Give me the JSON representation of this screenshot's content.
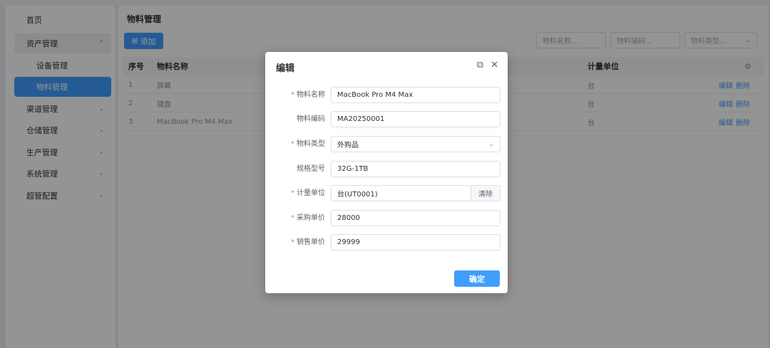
{
  "sidebar": {
    "items": [
      {
        "label": "首页",
        "chevron": ""
      },
      {
        "label": "资产管理",
        "chevron": "^"
      },
      {
        "label": "设备管理",
        "chevron": ""
      },
      {
        "label": "物料管理",
        "chevron": ""
      },
      {
        "label": "渠道管理",
        "chevron": "⌄"
      },
      {
        "label": "仓储管理",
        "chevron": "⌄"
      },
      {
        "label": "生产管理",
        "chevron": "⌄"
      },
      {
        "label": "系统管理",
        "chevron": "⌄"
      },
      {
        "label": "超管配置",
        "chevron": "⌄"
      }
    ]
  },
  "main": {
    "title": "物料管理",
    "add_label": "添加",
    "filters": {
      "name_placeholder": "物料名称...",
      "code_placeholder": "物料编码...",
      "type_placeholder": "物料类型..."
    },
    "table": {
      "headers": {
        "index": "序号",
        "name": "物料名称",
        "unit": "计量单位"
      },
      "rows": [
        {
          "index": "1",
          "name": "屏幕",
          "unit": "台",
          "edit": "编辑",
          "delete": "删除"
        },
        {
          "index": "2",
          "name": "键盘",
          "unit": "台",
          "edit": "编辑",
          "delete": "删除"
        },
        {
          "index": "3",
          "name": "MacBook Pro M4 Max",
          "unit": "台",
          "edit": "编辑",
          "delete": "删除"
        }
      ]
    }
  },
  "dialog": {
    "title": "编辑",
    "fields": {
      "name": {
        "label": "物料名称",
        "value": "MacBook Pro M4 Max"
      },
      "code": {
        "label": "物料编码",
        "value": "MA20250001"
      },
      "type": {
        "label": "物料类型",
        "value": "外购品"
      },
      "spec": {
        "label": "规格型号",
        "value": "32G-1TB"
      },
      "unit": {
        "label": "计量单位",
        "value": "台(UT0001)",
        "clear": "清除"
      },
      "purchase": {
        "label": "采购单价",
        "value": "28000"
      },
      "sale": {
        "label": "销售单价",
        "value": "29999"
      }
    },
    "confirm_label": "确定"
  },
  "colors": {
    "primary": "#409eff",
    "required": "#f56c6c"
  }
}
